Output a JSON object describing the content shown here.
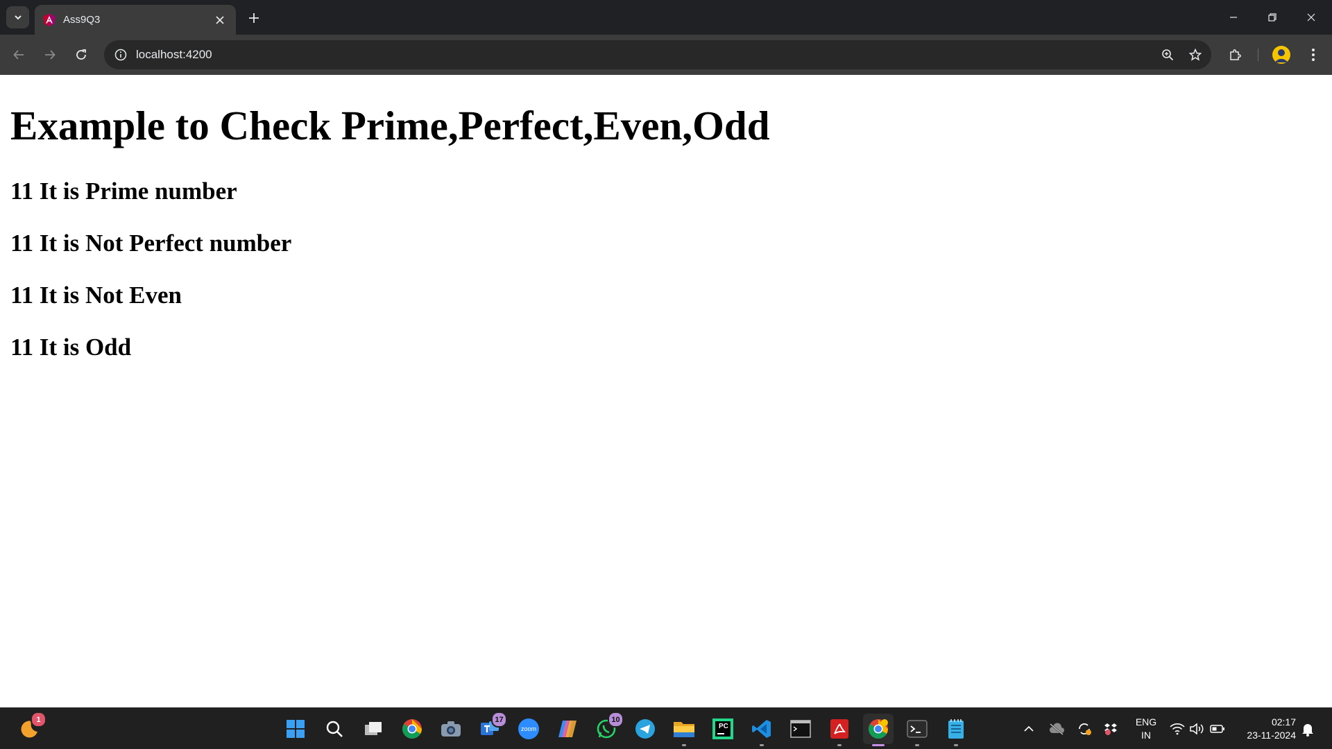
{
  "browser": {
    "tab_title": "Ass9Q3",
    "url": "localhost:4200"
  },
  "page": {
    "heading": "Example to Check Prime,Perfect,Even,Odd",
    "results": [
      "11 It is Prime number",
      "11 It is Not Perfect number",
      "11 It is Not Even",
      "11 It is Odd"
    ]
  },
  "taskbar": {
    "weather_badge": "1",
    "teams_badge": "17",
    "zoom_label": "zoom",
    "whatsapp_badge": "10",
    "pycharm_label": "PC",
    "lang_top": "ENG",
    "lang_bottom": "IN",
    "time": "02:17",
    "date": "23-11-2024"
  },
  "colors": {
    "tabstrip": "#202124",
    "toolbar": "#3c3c3c",
    "taskbar": "#202020",
    "angular_red": "#dd0031",
    "angular_purple": "#c3002f"
  }
}
